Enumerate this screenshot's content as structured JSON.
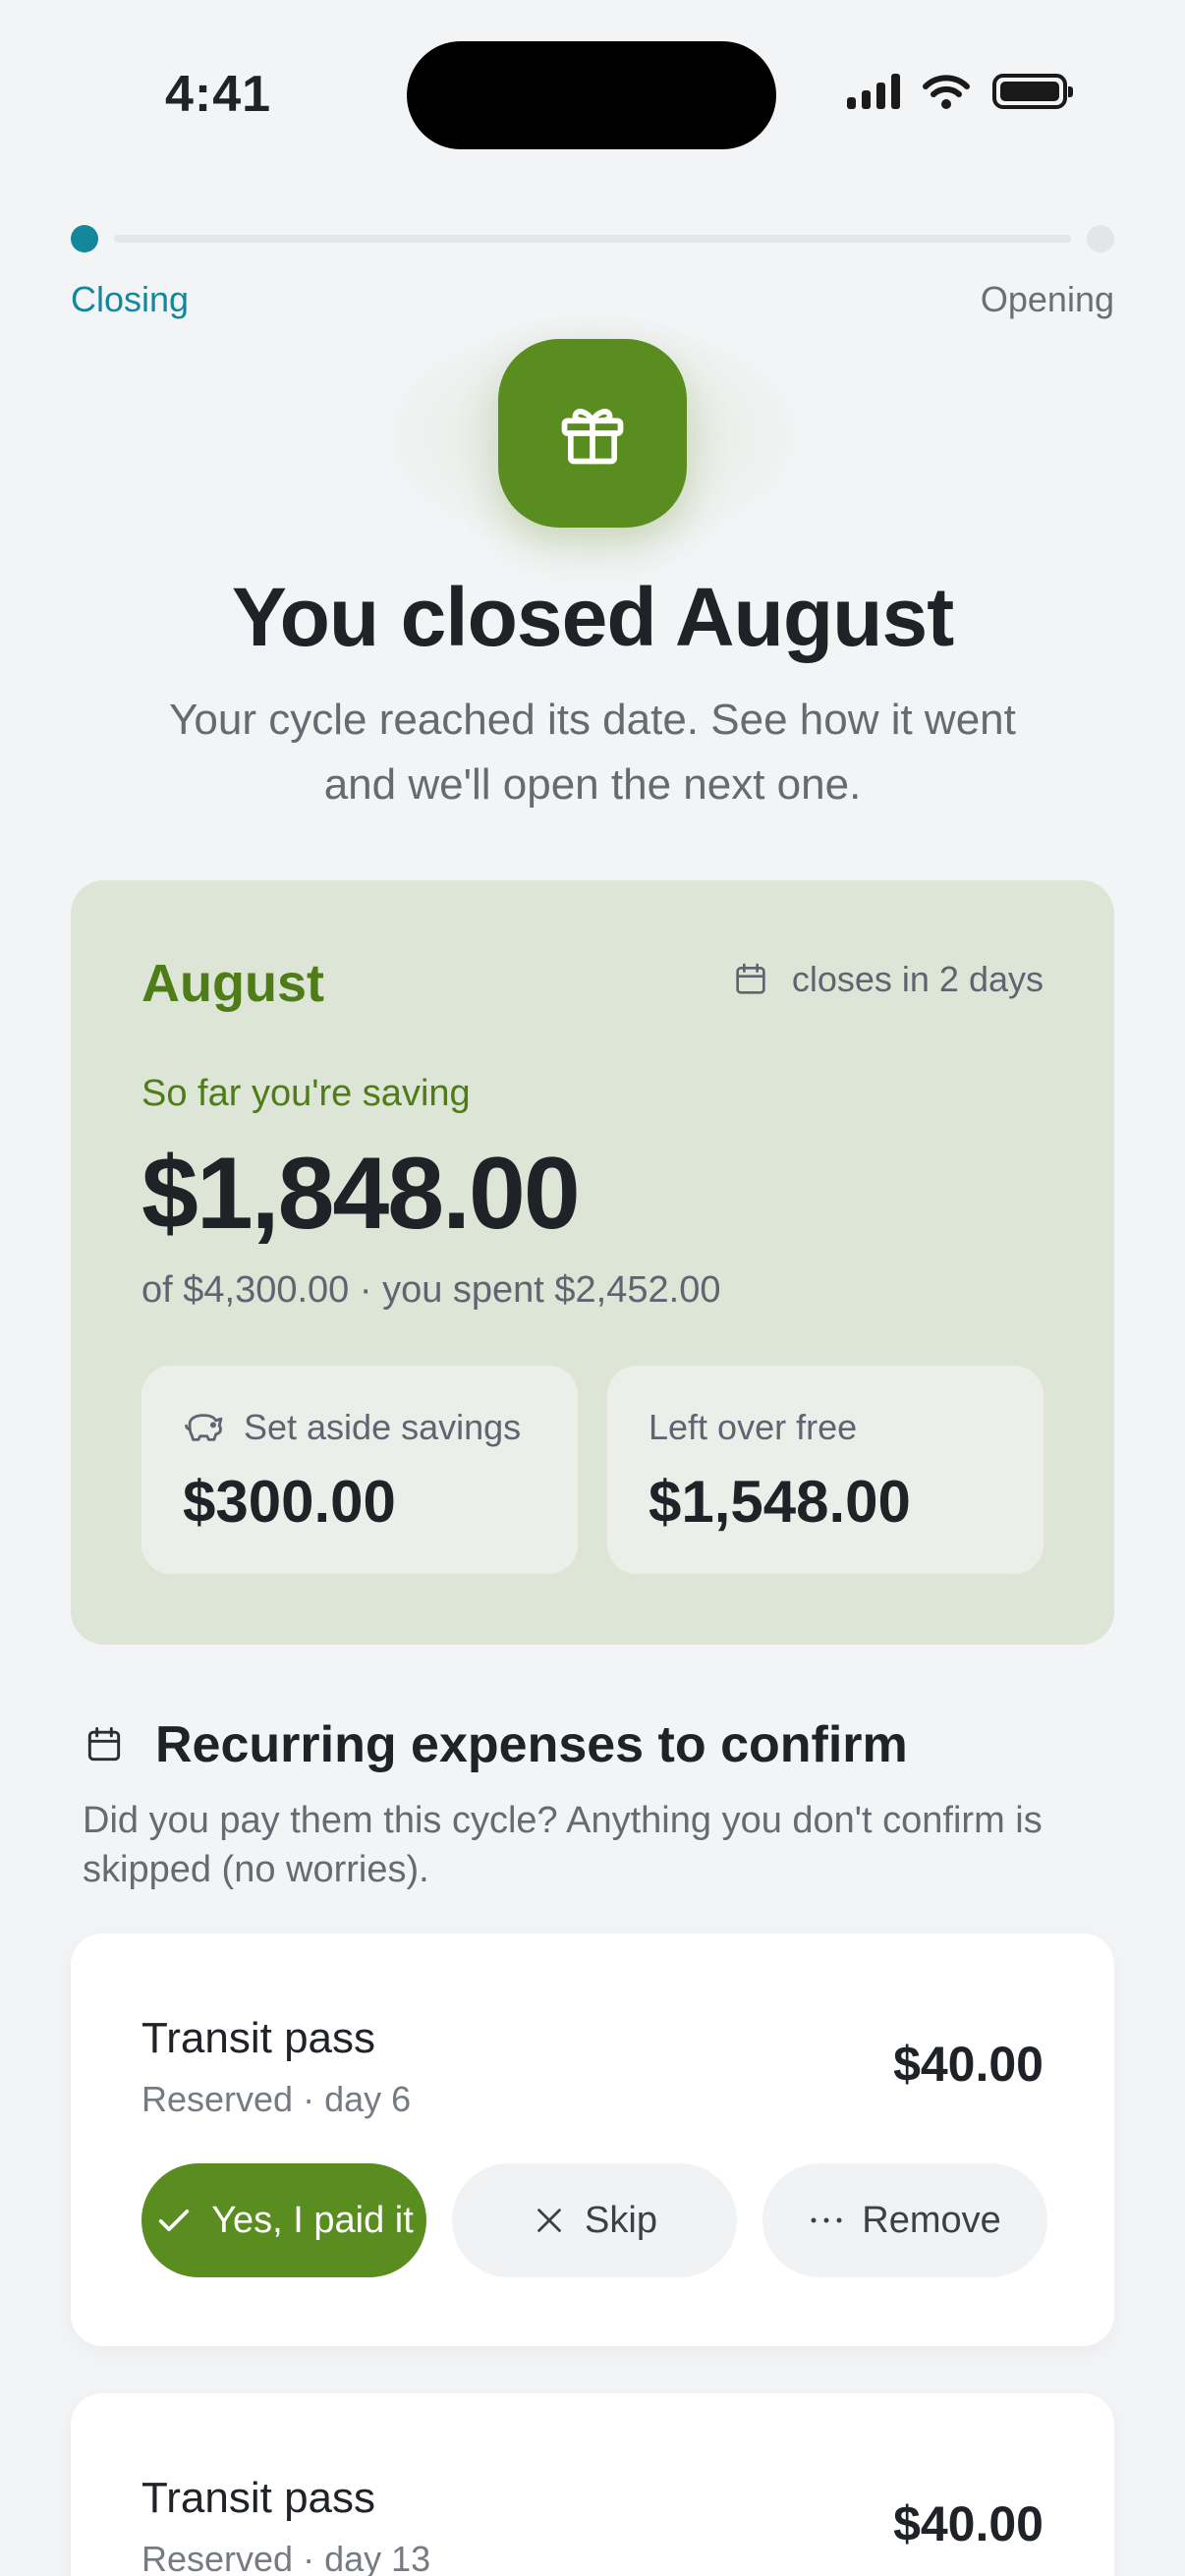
{
  "status_bar": {
    "time": "4:41"
  },
  "stepper": {
    "current_label": "Closing",
    "next_label": "Opening"
  },
  "hero": {
    "icon": "gift-icon",
    "title": "You closed August",
    "subtitle": "Your cycle reached its date. See how it went and we'll open the next one."
  },
  "summary": {
    "month": "August",
    "closes_text": "closes in 2 days",
    "saving_label": "So far you're saving",
    "saving_amount": "$1,848.00",
    "saving_detail": "of $4,300.00 · you spent $2,452.00",
    "set_aside": {
      "label": "Set aside savings",
      "amount": "$300.00",
      "icon": "piggy-bank-icon"
    },
    "left_over": {
      "label": "Left over free",
      "amount": "$1,548.00"
    }
  },
  "recurring": {
    "title": "Recurring expenses to confirm",
    "description": "Did you pay them this cycle? Anything you don't confirm is skipped (no worries).",
    "items": [
      {
        "name": "Transit pass",
        "meta": "Reserved · day 6",
        "amount": "$40.00",
        "actions": {
          "confirm": "Yes, I paid it",
          "skip": "Skip",
          "remove": "Remove"
        }
      },
      {
        "name": "Transit pass",
        "meta": "Reserved · day 13",
        "amount": "$40.00"
      }
    ]
  },
  "colors": {
    "accent_green": "#5a8d20",
    "accent_teal": "#13879b",
    "card_green": "#dde5d7"
  }
}
